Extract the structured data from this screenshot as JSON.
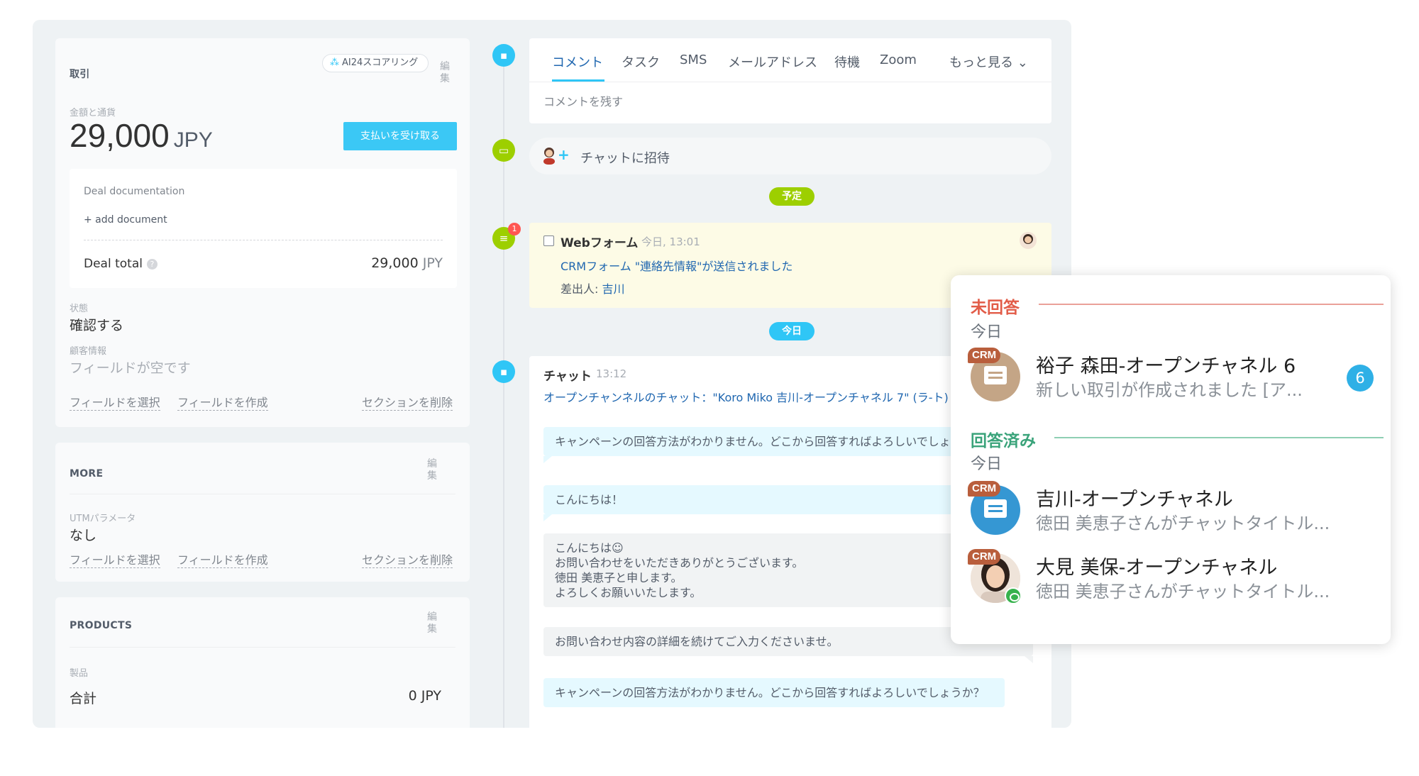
{
  "deal": {
    "title": "取引",
    "ai_button": "AI24スコアリング",
    "edit": "編\n集",
    "amount_label": "金額と通貨",
    "amount_value": "29,000",
    "amount_currency": "JPY",
    "pay_button": "支払いを受け取る",
    "doc_label": "Deal documentation",
    "add_document": "+ add document",
    "total_label": "Deal total",
    "total_value": "29,000",
    "total_currency": "JPY",
    "status_label": "状態",
    "status_value": "確認する",
    "customer_label": "顧客情報",
    "customer_value": "フィールドが空です",
    "select_field": "フィールドを選択",
    "create_field": "フィールドを作成",
    "delete_section": "セクションを削除"
  },
  "more": {
    "title": "MORE",
    "edit": "編\n集",
    "utm_label": "UTMパラメータ",
    "utm_value": "なし",
    "select_field": "フィールドを選択",
    "create_field": "フィールドを作成",
    "delete_section": "セクションを削除"
  },
  "products": {
    "title": "PRODUCTS",
    "edit": "編\n集",
    "product_label": "製品",
    "total_label": "合計",
    "total_value": "0 JPY"
  },
  "tabs": [
    "コメント",
    "タスク",
    "SMS",
    "メールアドレス",
    "待機",
    "Zoom",
    "もっと見る ⌄"
  ],
  "comment_placeholder": "コメントを残す",
  "chat_invite": "チャットに招待",
  "pill_scheduled": "予定",
  "pill_today": "今日",
  "web_badge": "1",
  "webform": {
    "title": "Webフォーム",
    "time": "今日, 13:01",
    "link": "CRMフォーム \"連絡先情報\"が送信されました",
    "sender_prefix": "差出人: ",
    "sender": "吉川"
  },
  "chat": {
    "title": "チャット",
    "time": "13:12",
    "link": "オープンチャンネルのチャット：\"Koro Miko 吉川-オープンチャネル 7\" (ラ-ト)",
    "messages": [
      "キャンペーンの回答方法がわかりません。どこから回答すればよろしいでしょうか？",
      "こんにちは！",
      "こんにちは☺\nお問い合わせをいただきありがとうございます。\n徳田 美恵子と申します。\nよろしくお願いいたします。",
      "お問い合わせ内容の詳細を続けてご入力くださいませ。",
      "キャンペーンの回答方法がわかりません。どこから回答すればよろしいでしょうか？"
    ]
  },
  "popup": {
    "unanswered": "未回答",
    "answered": "回答済み",
    "today": "今日",
    "crm": "CRM",
    "items": [
      {
        "name": "裕子 森田-オープンチャネル 6",
        "sub": "新しい取引が作成されました [ア...",
        "count": "6"
      },
      {
        "name": "吉川-オープンチャネル",
        "sub": "徳田 美恵子さんがチャットタイトル..."
      },
      {
        "name": "大見 美保-オープンチャネル",
        "sub": "徳田 美恵子さんがチャットタイトル..."
      }
    ]
  },
  "colors": {
    "accent": "#2fc6f6",
    "green": "#9dcf00",
    "link": "#2067b0",
    "unanswered": "#e25c48",
    "answered": "#3aa37a"
  }
}
